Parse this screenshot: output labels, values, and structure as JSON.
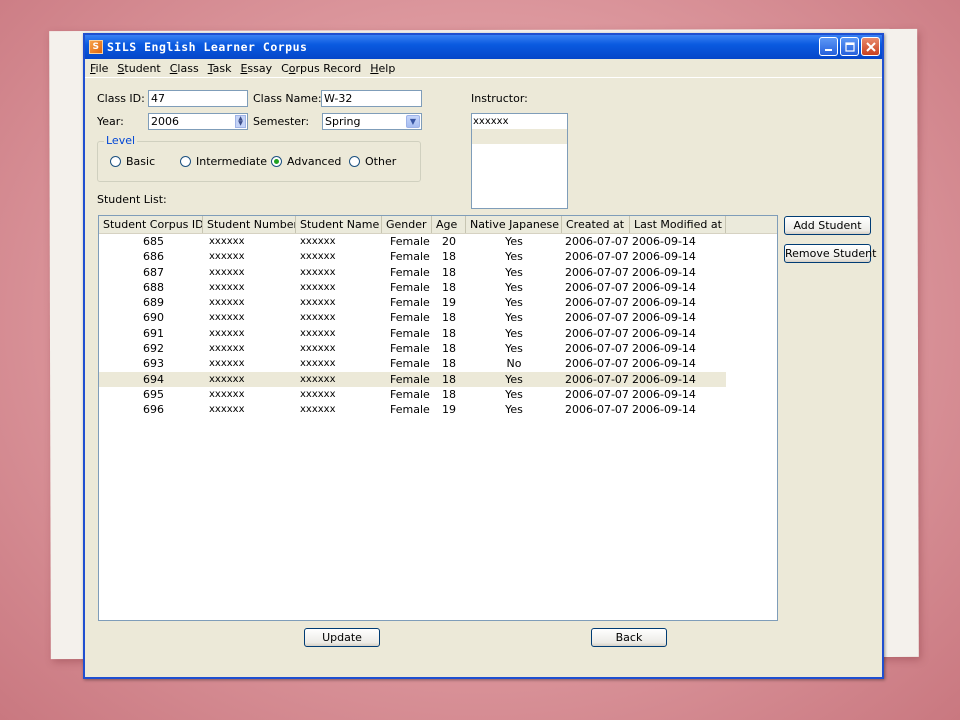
{
  "window": {
    "title": "SILS English Learner Corpus",
    "app_icon": "S"
  },
  "menu": [
    {
      "pre": "",
      "u": "F",
      "post": "ile"
    },
    {
      "pre": "",
      "u": "S",
      "post": "tudent"
    },
    {
      "pre": "",
      "u": "C",
      "post": "lass"
    },
    {
      "pre": "",
      "u": "T",
      "post": "ask"
    },
    {
      "pre": "",
      "u": "E",
      "post": "ssay"
    },
    {
      "pre": "C",
      "u": "o",
      "post": "rpus Record"
    },
    {
      "pre": "",
      "u": "H",
      "post": "elp"
    }
  ],
  "form": {
    "class_id_label": "Class ID:",
    "class_id_value": "47",
    "class_name_label": "Class Name:",
    "class_name_value": "W-32",
    "instructor_label": "Instructor:",
    "year_label": "Year:",
    "year_value": "2006",
    "semester_label": "Semester:",
    "semester_value": "Spring",
    "level_title": "Level",
    "levels": [
      "Basic",
      "Intermediate",
      "Advanced",
      "Other"
    ],
    "selected_level": "Advanced",
    "student_list_label": "Student List:"
  },
  "instructors": [
    {
      "name": "xxxxxx"
    },
    {
      "name": ""
    }
  ],
  "table": {
    "columns": [
      "Student Corpus ID",
      "Student Number",
      "Student Name",
      "Gender",
      "Age",
      "Native Japanese",
      "Created at",
      "Last Modified at"
    ],
    "selected_row": 9,
    "rows": [
      [
        "685",
        "xxxxxx",
        "xxxxxx",
        "Female",
        "20",
        "Yes",
        "2006-07-07",
        "2006-09-14"
      ],
      [
        "686",
        "xxxxxx",
        "xxxxxx",
        "Female",
        "18",
        "Yes",
        "2006-07-07",
        "2006-09-14"
      ],
      [
        "687",
        "xxxxxx",
        "xxxxxx",
        "Female",
        "18",
        "Yes",
        "2006-07-07",
        "2006-09-14"
      ],
      [
        "688",
        "xxxxxx",
        "xxxxxx",
        "Female",
        "18",
        "Yes",
        "2006-07-07",
        "2006-09-14"
      ],
      [
        "689",
        "xxxxxx",
        "xxxxxx",
        "Female",
        "19",
        "Yes",
        "2006-07-07",
        "2006-09-14"
      ],
      [
        "690",
        "xxxxxx",
        "xxxxxx",
        "Female",
        "18",
        "Yes",
        "2006-07-07",
        "2006-09-14"
      ],
      [
        "691",
        "xxxxxx",
        "xxxxxx",
        "Female",
        "18",
        "Yes",
        "2006-07-07",
        "2006-09-14"
      ],
      [
        "692",
        "xxxxxx",
        "xxxxxx",
        "Female",
        "18",
        "Yes",
        "2006-07-07",
        "2006-09-14"
      ],
      [
        "693",
        "xxxxxx",
        "xxxxxx",
        "Female",
        "18",
        "No",
        "2006-07-07",
        "2006-09-14"
      ],
      [
        "694",
        "xxxxxx",
        "xxxxxx",
        "Female",
        "18",
        "Yes",
        "2006-07-07",
        "2006-09-14"
      ],
      [
        "695",
        "xxxxxx",
        "xxxxxx",
        "Female",
        "18",
        "Yes",
        "2006-07-07",
        "2006-09-14"
      ],
      [
        "696",
        "xxxxxx",
        "xxxxxx",
        "Female",
        "19",
        "Yes",
        "2006-07-07",
        "2006-09-14"
      ]
    ]
  },
  "buttons": {
    "add_student": "Add Student",
    "remove_student": "Remove Student",
    "update": "Update",
    "back": "Back"
  },
  "colors": {
    "titlebar": "#0a5ae0",
    "window_bg": "#ece9d8",
    "group_title": "#0046d5",
    "background": "#dc979d"
  }
}
